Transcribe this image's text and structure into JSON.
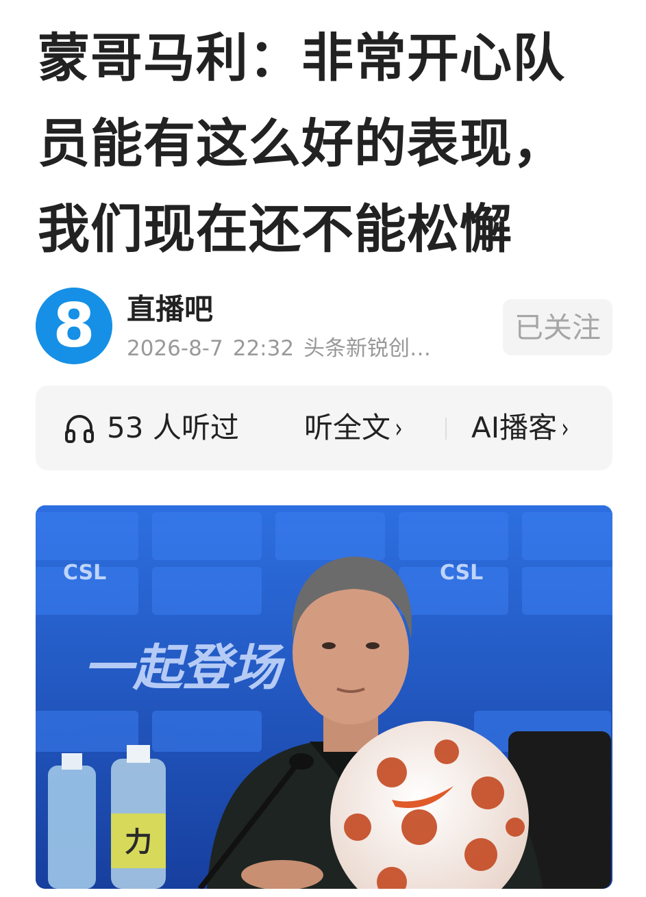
{
  "article": {
    "title_lines": [
      "蒙哥马利：非常开心队",
      "员能有这么好的表现，",
      "我们现在还不能松懈"
    ]
  },
  "author": {
    "name": "直播吧",
    "avatar_glyph": "8",
    "avatar_color": "#1590e6",
    "date": "2026-8-7",
    "time": "22:32",
    "tag": "头条新锐创…",
    "follow_label": "已关注"
  },
  "audio": {
    "listeners_count": "53",
    "listeners_label": "人听过",
    "listen_full_label": "听全文",
    "ai_podcast_label": "AI播客",
    "chevron": "›",
    "icon": "headphone-icon"
  },
  "photo": {
    "backdrop_text": "一起登场",
    "brand_mark": "CSL",
    "bottle_text": "力"
  }
}
